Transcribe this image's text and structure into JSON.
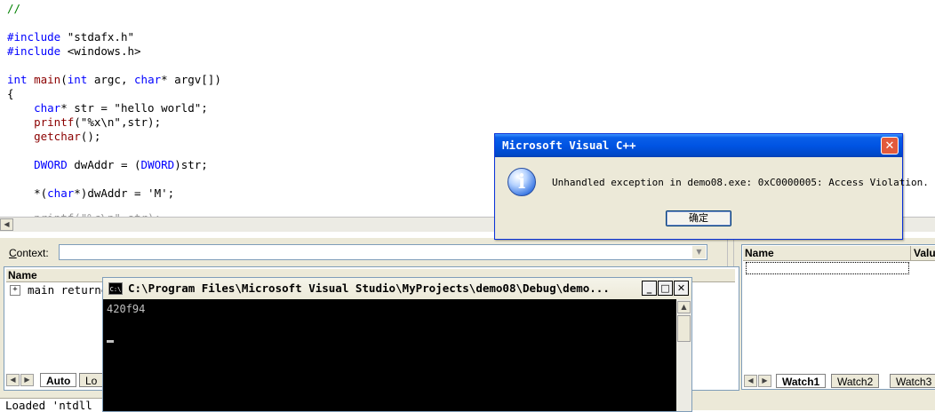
{
  "editor": {
    "lines": [
      {
        "text": "//",
        "cls": "cm"
      },
      {
        "text": "",
        "cls": ""
      },
      {
        "text": "#include \"stdafx.h\"",
        "cls": "inc1"
      },
      {
        "text": "#include <windows.h>",
        "cls": "inc2"
      },
      {
        "text": "",
        "cls": ""
      },
      {
        "text": "int main(int argc, char* argv[])",
        "cls": "main"
      },
      {
        "text": "{",
        "cls": ""
      },
      {
        "text": "    char* str = \"hello world\";",
        "cls": "charstr"
      },
      {
        "text": "    printf(\"%x\\n\",str);",
        "cls": "printf"
      },
      {
        "text": "    getchar();",
        "cls": "getchar"
      },
      {
        "text": "",
        "cls": ""
      },
      {
        "text": "    DWORD dwAddr = (DWORD)str;",
        "cls": "dword"
      },
      {
        "text": "",
        "cls": ""
      },
      {
        "text": "    *(char*)dwAddr = 'M';",
        "cls": "assign"
      }
    ]
  },
  "context": {
    "label": "Context:"
  },
  "variables": {
    "header_name": "Name",
    "header_dots": "...",
    "row1": "main returne",
    "tabs": [
      "Auto",
      "Lo"
    ]
  },
  "status": {
    "text": "Loaded 'ntdll"
  },
  "watch": {
    "header_name": "Name",
    "header_value": "Valu",
    "tabs": [
      "Watch1",
      "Watch2",
      "Watch3"
    ]
  },
  "msgbox": {
    "title": "Microsoft Visual C++",
    "message": "Unhandled exception in demo08.exe: 0xC0000005: Access Violation.",
    "ok_label": "确定",
    "close_glyph": "✕",
    "icon": "info-icon"
  },
  "console": {
    "title": "C:\\Program Files\\Microsoft Visual Studio\\MyProjects\\demo08\\Debug\\demo...",
    "icon_text": "C:\\",
    "output": "420f94",
    "min": "_",
    "max": "□",
    "close": "✕"
  },
  "colors": {
    "keyword": "#0000ff",
    "function": "#8b0000",
    "comment": "#008000",
    "titlebar": "#0054e3"
  }
}
